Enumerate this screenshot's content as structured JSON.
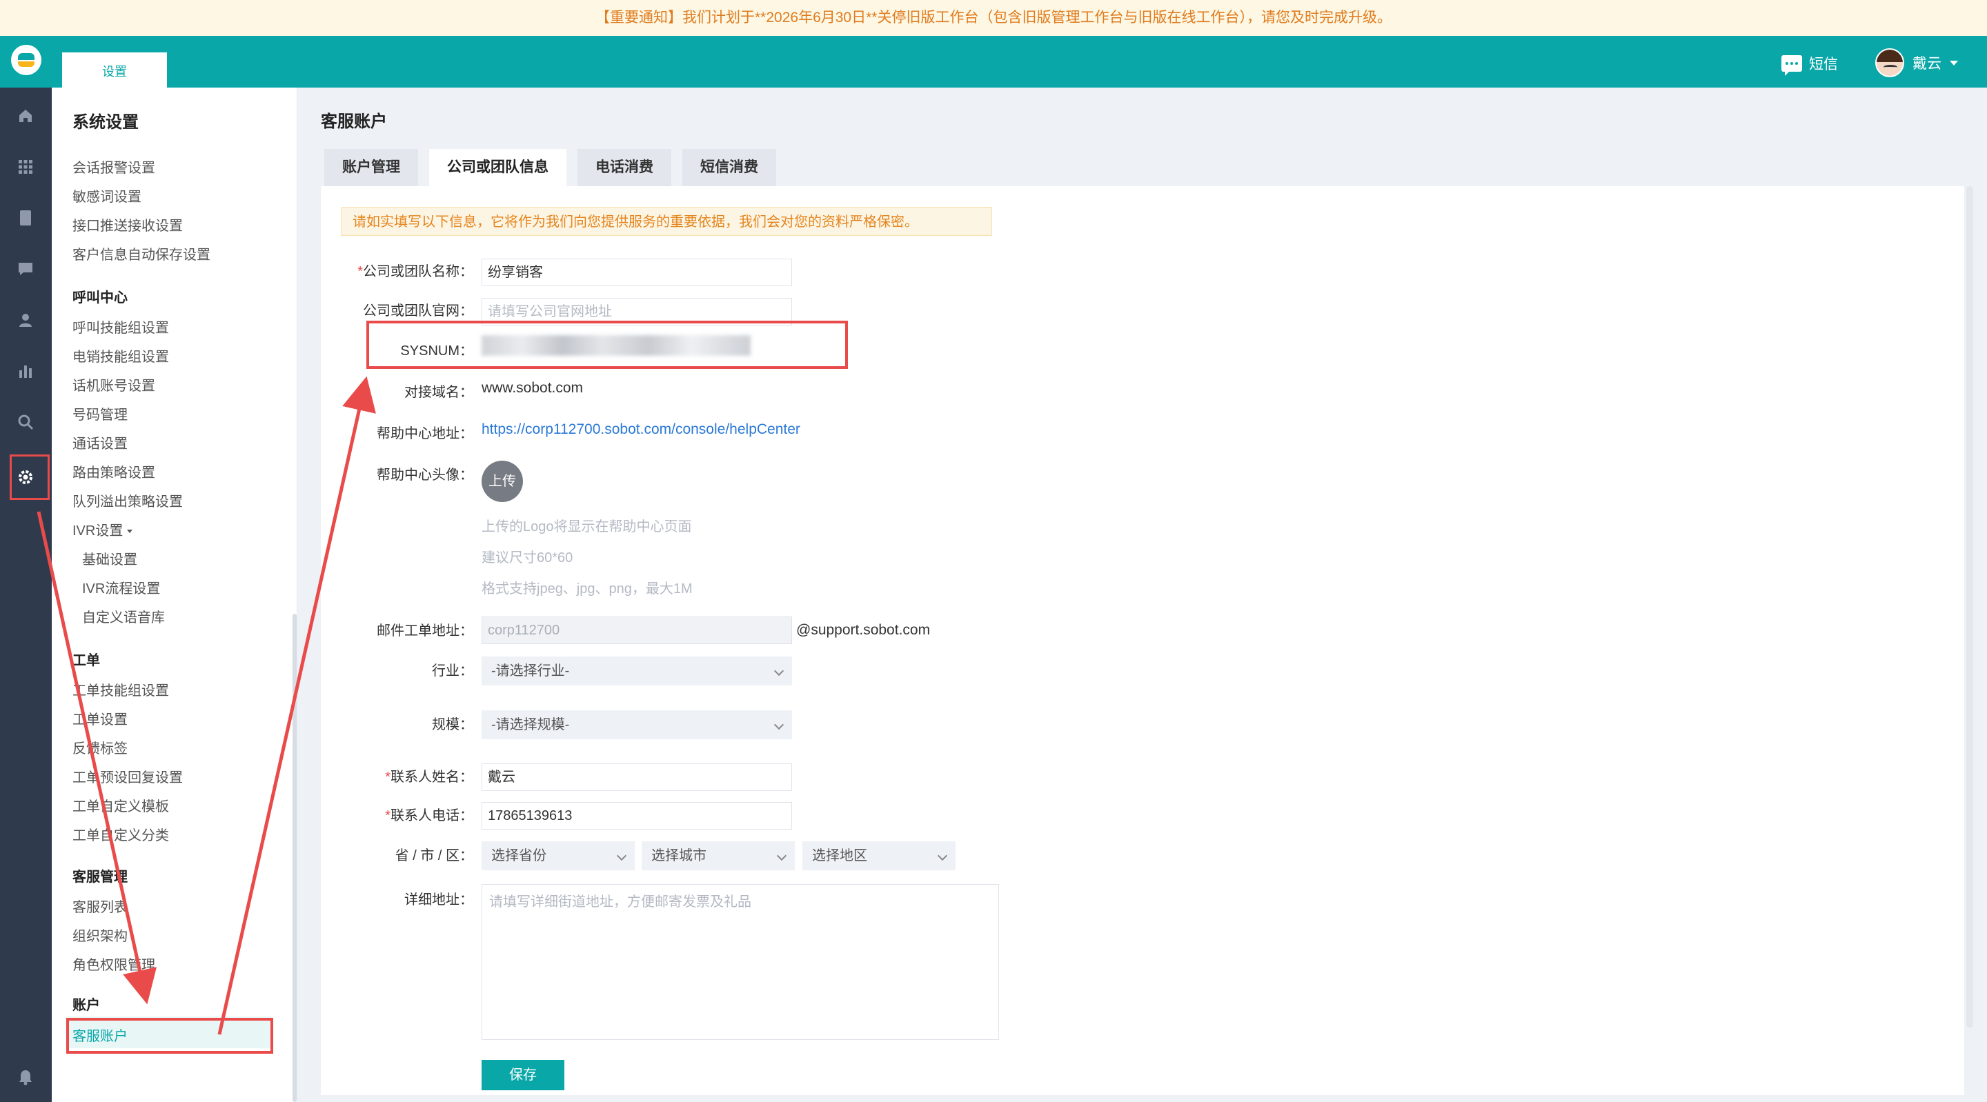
{
  "notice": "【重要通知】我们计划于**2026年6月30日**关停旧版工作台（包含旧版管理工作台与旧版在线工作台），请您及时完成升级。",
  "topbar": {
    "tab_label": "设置",
    "sms_label": "短信",
    "user_name": "戴云",
    "brand_color": "#0aa7a9"
  },
  "leftbar": {
    "icons": [
      "home-icon",
      "apps-icon",
      "document-icon",
      "chat-icon",
      "customer-icon",
      "chart-icon",
      "search-icon",
      "settings-icon",
      "bell-icon"
    ],
    "active": "settings-icon"
  },
  "menu": {
    "title": "系统设置",
    "general": [
      "会话报警设置",
      "敏感词设置",
      "接口推送接收设置",
      "客户信息自动保存设置"
    ],
    "call_center_heading": "呼叫中心",
    "call_center": [
      "呼叫技能组设置",
      "电销技能组设置",
      "话机账号设置",
      "号码管理",
      "通话设置",
      "路由策略设置",
      "队列溢出策略设置"
    ],
    "ivr_label": "IVR设置",
    "ivr_items": [
      "基础设置",
      "IVR流程设置",
      "自定义语音库"
    ],
    "ticket_heading": "工单",
    "ticket": [
      "工单技能组设置",
      "工单设置",
      "反馈标签",
      "工单预设回复设置",
      "工单自定义模板",
      "工单自定义分类"
    ],
    "agent_heading": "客服管理",
    "agent": [
      "客服列表",
      "组织架构",
      "角色权限管理"
    ],
    "account_heading": "账户",
    "account": [
      "客服账户"
    ]
  },
  "page": {
    "title": "客服账户",
    "tabs": [
      "账户管理",
      "公司或团队信息",
      "电话消费",
      "短信消费"
    ],
    "active_tab": 1,
    "hint": "请如实填写以下信息，它将作为我们向您提供服务的重要依据，我们会对您的资料严格保密。"
  },
  "form": {
    "company_label": "公司或团队名称：",
    "company_value": "纷享销客",
    "website_label": "公司或团队官网：",
    "website_placeholder": "请填写公司官网地址",
    "sysnum_label": "SYSNUM：",
    "domain_label": "对接域名：",
    "domain_value": "www.sobot.com",
    "help_url_label": "帮助中心地址：",
    "help_url_value": "https://corp112700.sobot.com/console/helpCenter",
    "avatar_label": "帮助中心头像：",
    "upload_label": "上传",
    "upload_tips": [
      "上传的Logo将显示在帮助中心页面",
      "建议尺寸60*60",
      "格式支持jpeg、jpg、png，最大1M"
    ],
    "email_label": "邮件工单地址：",
    "email_value": "corp112700",
    "email_suffix": "@support.sobot.com",
    "industry_label": "行业：",
    "industry_value": "-请选择行业-",
    "scale_label": "规模：",
    "scale_value": "-请选择规模-",
    "contact_name_label": "联系人姓名：",
    "contact_name_value": "戴云",
    "contact_phone_label": "联系人电话：",
    "contact_phone_value": "17865139613",
    "region_label": "省 / 市 / 区：",
    "province_value": "选择省份",
    "city_value": "选择城市",
    "district_value": "选择地区",
    "address_label": "详细地址：",
    "address_placeholder": "请填写详细街道地址，方便邮寄发票及礼品",
    "save_label": "保存",
    "required_mark": "*"
  },
  "annotations": {
    "highlight_color": "#e94b4b"
  }
}
